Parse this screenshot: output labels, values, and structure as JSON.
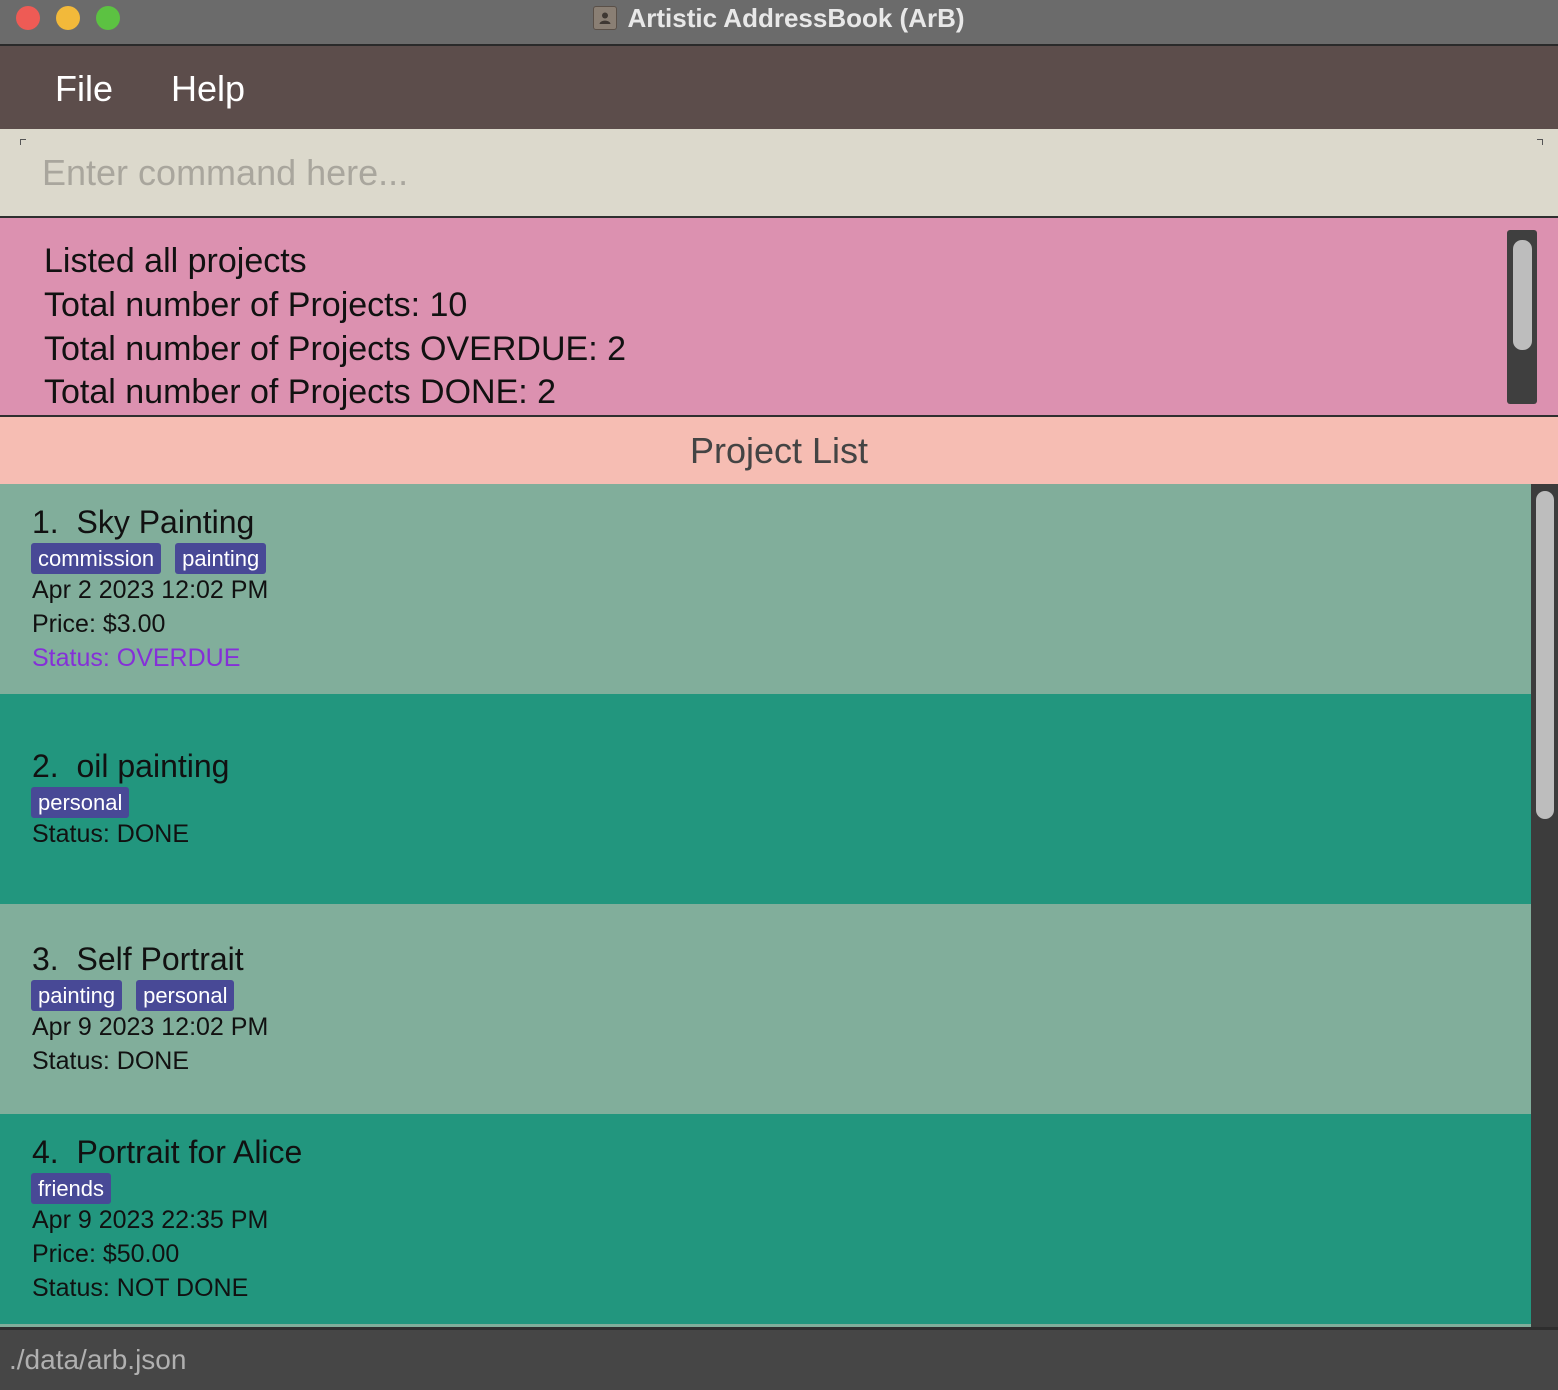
{
  "window": {
    "title": "Artistic AddressBook (ArB)",
    "icon": "contacts-book-icon"
  },
  "menu": {
    "items": [
      "File",
      "Help"
    ]
  },
  "command": {
    "value": "",
    "placeholder": "Enter command here..."
  },
  "result": {
    "lines": [
      "Listed all projects",
      "Total number of Projects: 10",
      "Total number of Projects OVERDUE: 2",
      "Total number of Projects DONE: 2"
    ]
  },
  "list": {
    "header": "Project List",
    "projects": [
      {
        "index": "1.",
        "name": "Sky Painting",
        "tags": [
          "commission",
          "painting"
        ],
        "deadline": "Apr 2 2023 12:02 PM",
        "price": "Price: $3.00",
        "status": "Status: OVERDUE"
      },
      {
        "index": "2.",
        "name": "oil painting",
        "tags": [
          "personal"
        ],
        "status": "Status: DONE"
      },
      {
        "index": "3.",
        "name": "Self Portrait",
        "tags": [
          "painting",
          "personal"
        ],
        "deadline": "Apr 9 2023 12:02 PM",
        "status": "Status: DONE"
      },
      {
        "index": "4.",
        "name": "Portrait for Alice",
        "tags": [
          "friends"
        ],
        "deadline": "Apr 9 2023 22:35 PM",
        "price": "Price: $50.00",
        "status": "Status: NOT DONE"
      }
    ]
  },
  "status_bar": {
    "path": "./data/arb.json"
  },
  "colors": {
    "menubar": "#5c4d4b",
    "command_bg": "#dcd9cc",
    "result_bg": "#dc91b0",
    "list_header_bg": "#f6bdb3",
    "card_light": "#81ae9b",
    "card_dark": "#22967e",
    "tag_bg": "#484996",
    "overdue": "#8530d8"
  }
}
